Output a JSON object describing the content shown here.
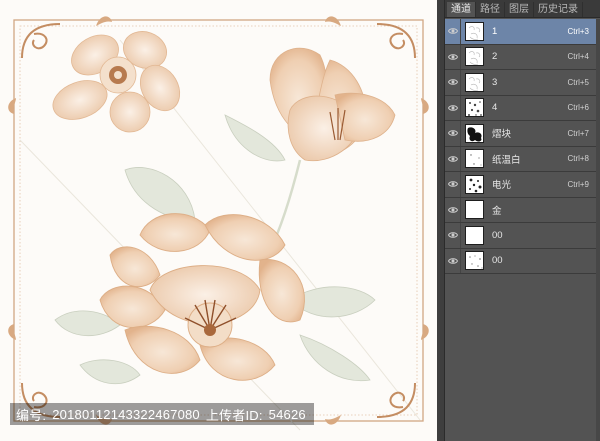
{
  "panel": {
    "tabs": [
      {
        "label": "通道",
        "active": true
      },
      {
        "label": "路径",
        "active": false
      },
      {
        "label": "图层",
        "active": false
      },
      {
        "label": "历史记录",
        "active": false
      }
    ],
    "channels": [
      {
        "name": "1",
        "shortcut": "Ctrl+3",
        "visible": true,
        "selected": true,
        "thumb": "sketch-light"
      },
      {
        "name": "2",
        "shortcut": "Ctrl+4",
        "visible": true,
        "selected": false,
        "thumb": "sketch-light"
      },
      {
        "name": "3",
        "shortcut": "Ctrl+5",
        "visible": true,
        "selected": false,
        "thumb": "sketch-light"
      },
      {
        "name": "4",
        "shortcut": "Ctrl+6",
        "visible": true,
        "selected": false,
        "thumb": "speckle"
      },
      {
        "name": "熠块",
        "shortcut": "Ctrl+7",
        "visible": true,
        "selected": false,
        "thumb": "dark-blot"
      },
      {
        "name": "纸温白",
        "shortcut": "Ctrl+8",
        "visible": true,
        "selected": false,
        "thumb": "sparse-dots"
      },
      {
        "name": "电光",
        "shortcut": "Ctrl+9",
        "visible": true,
        "selected": false,
        "thumb": "scatter"
      },
      {
        "name": "金",
        "shortcut": "",
        "visible": true,
        "selected": false,
        "thumb": "blank"
      },
      {
        "name": "00",
        "shortcut": "",
        "visible": true,
        "selected": false,
        "thumb": "blank"
      },
      {
        "name": "00",
        "shortcut": "",
        "visible": true,
        "selected": false,
        "thumb": "speckle-light"
      }
    ]
  },
  "watermark": {
    "id_label": "编号:",
    "id_value": "20180112143322467080",
    "uploader_label": "上传者ID:",
    "uploader_value": "54626"
  },
  "colors": {
    "canvas_bg": "#fdfbf8",
    "petal": "#f1d7bf",
    "petal_shadow": "#e2b894",
    "stamen": "#9a5a32",
    "leaf": "#dfe3d6",
    "frame": "#c79a72",
    "selected_row": "#6d85a8"
  }
}
